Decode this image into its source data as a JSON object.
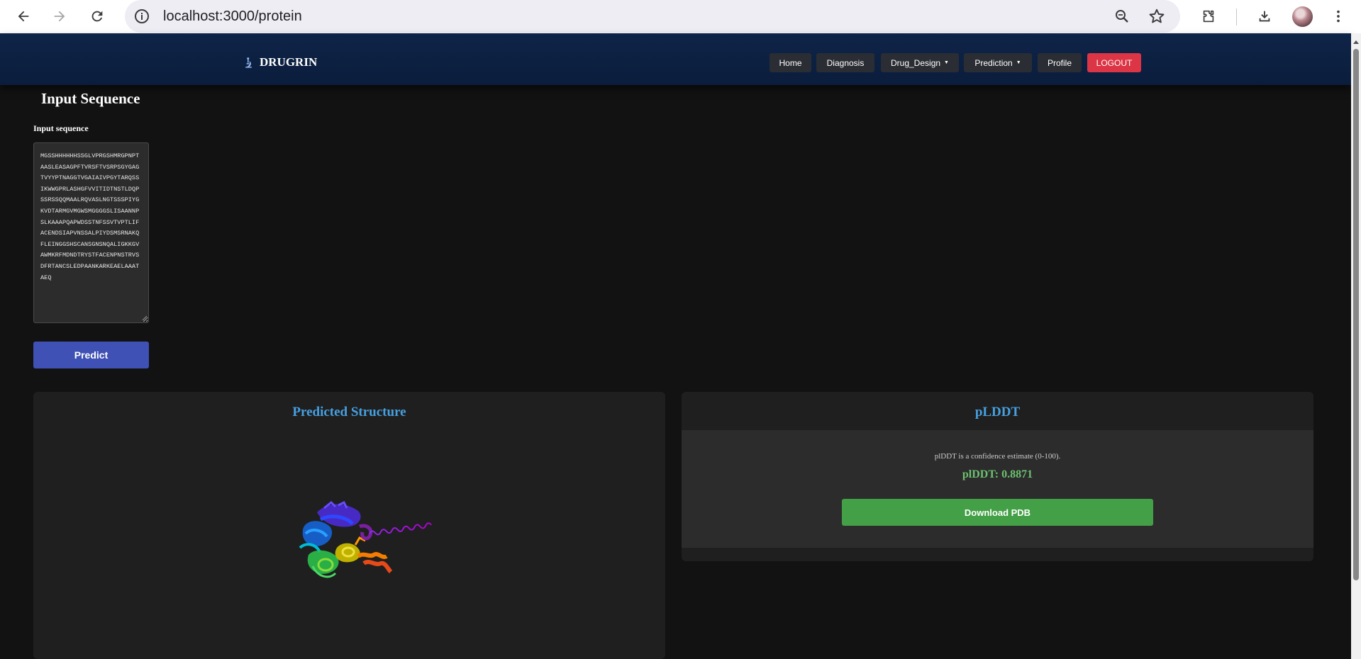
{
  "browser": {
    "url": "localhost:3000/protein",
    "icons": [
      "back-icon",
      "forward-icon",
      "reload-icon",
      "info-icon",
      "zoom-icon",
      "star-icon",
      "extensions-icon",
      "download-icon",
      "profile-avatar",
      "menu-icon"
    ]
  },
  "navbar": {
    "brand": "DRUGRIN",
    "brand_icon": "microscope-icon",
    "items": [
      {
        "label": "Home"
      },
      {
        "label": "Diagnosis"
      },
      {
        "label": "Drug_Design",
        "dropdown": true
      },
      {
        "label": "Prediction",
        "dropdown": true
      },
      {
        "label": "Profile"
      },
      {
        "label": "LOGOUT"
      }
    ],
    "caret": "▼"
  },
  "input": {
    "section_title": "Input Sequence",
    "label": "Input sequence",
    "sequence": "MGSSHHHHHHSSGLVPRGSHMRGPNPTAASLEASAGPFTVRSFTVSRPSGYGAGTVYYPTNAGGTVGAIAIVPGYTARQSSIKWWGPRLASHGFVVITIDTNSTLDQPSSRSSQQMAALRQVASLNGTSSSPIYGKVDTARMGVMGWSMGGGGSLISAANNPSLKAAAPQAPWDSSTNFSSVTVPTLIFACENDSIAPVNSSALPIYDSMSRNAKQFLEINGGSHSCANSGNSNQALIGKKGVAWMKRFMDNDTRYSTFACENPNSTRVSDFRTANCSLEDPAANKARKEAELAAATAEQ",
    "predict_label": "Predict"
  },
  "structure": {
    "title": "Predicted Structure"
  },
  "plddt": {
    "title": "pLDDT",
    "description": "plDDT is a confidence estimate (0-100).",
    "value_text": "plDDT: 0.8871",
    "value": 0.8871,
    "download_label": "Download PDB"
  },
  "colors": {
    "navbar": "#0e2448",
    "accent_blue": "#3f51b5",
    "title_blue": "#46a0e0",
    "logout_red": "#dc3545",
    "download_green": "#43a047",
    "plddt_green": "#6cc070"
  }
}
